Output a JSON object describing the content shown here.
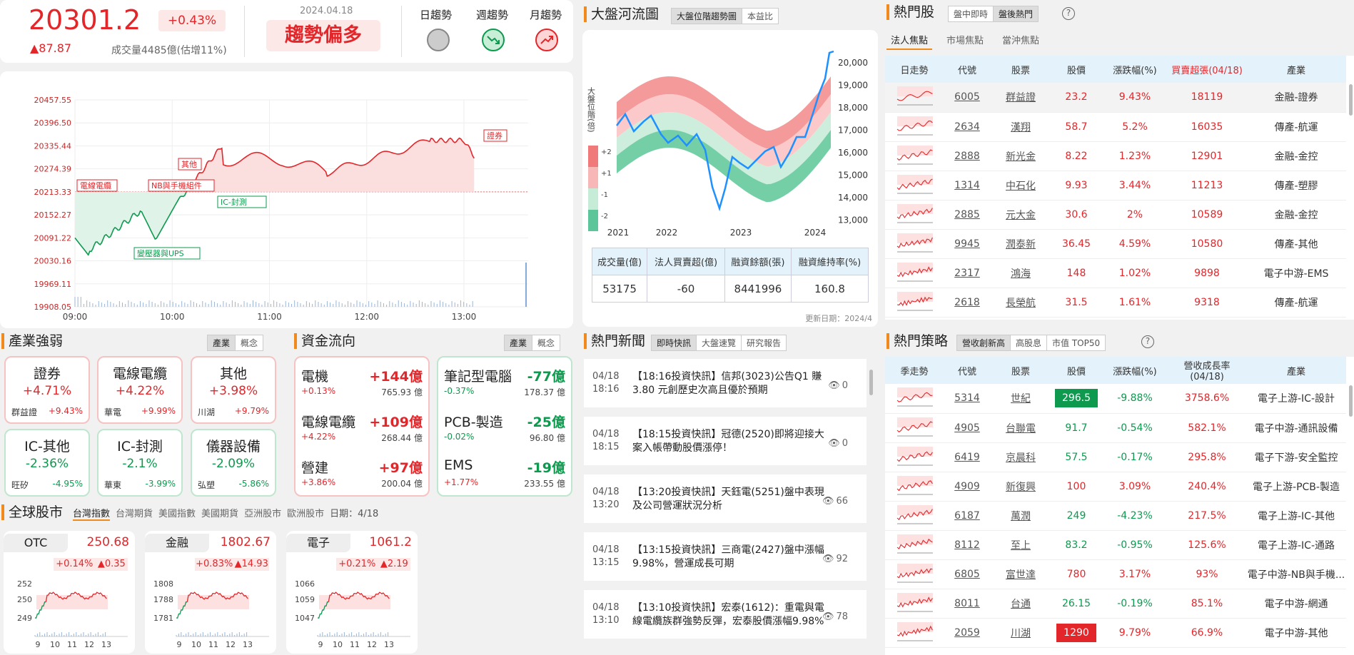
{
  "index": {
    "value": "20301.2",
    "change_pct": "+0.43%",
    "change_pts": "▲87.87",
    "volume": "成交量4485億(估增11%)",
    "date": "2024.04.18",
    "trend": "趨勢偏多",
    "trend_labels": [
      "日趨勢",
      "週趨勢",
      "月趨勢"
    ]
  },
  "main_chart": {
    "type": "line",
    "y_ticks": [
      "20457.55",
      "20396.50",
      "20335.44",
      "20274.39",
      "20213.33",
      "20152.27",
      "20091.22",
      "20030.16",
      "19969.11",
      "19908.05"
    ],
    "x_ticks": [
      "09:00",
      "10:00",
      "11:00",
      "12:00",
      "13:00"
    ],
    "reference": 20213.33,
    "ylim": [
      19908.05,
      20457.55
    ],
    "annotations": [
      "電線電纜",
      "NB與手機組件",
      "其他",
      "IC-封測",
      "變壓器與UPS",
      "證券"
    ]
  },
  "river": {
    "title": "大盤河流圖",
    "tabs": [
      "大盤位階趨勢圖",
      "本益比"
    ],
    "y_label": "大盤位階(倍)",
    "legend": [
      "+2",
      "+1",
      "-1",
      "-2"
    ],
    "y_ticks": [
      "20,000",
      "19,000",
      "18,000",
      "17,000",
      "16,000",
      "15,000",
      "14,000",
      "13,000"
    ],
    "x_ticks": [
      "2021",
      "2022",
      "2023",
      "2024"
    ],
    "table_headers": [
      "成交量(億)",
      "法人買賣超(億)",
      "融資餘額(張)",
      "融資維持率(%)"
    ],
    "table_values": [
      "53175",
      "-60",
      "8441996",
      "160.8"
    ],
    "updated": "更新日期：2024/4"
  },
  "hot_stocks": {
    "title": "熱門股",
    "tabs": [
      "盤中即時",
      "盤後熱門"
    ],
    "subtabs": [
      "法人焦點",
      "市場焦點",
      "當沖焦點"
    ],
    "headers": [
      "日走勢",
      "代號",
      "股票",
      "股價",
      "漲跌幅(%)",
      "買賣超張(04/18)",
      "產業"
    ],
    "rows": [
      {
        "code": "6005",
        "name": "群益證",
        "price": "23.2",
        "pct": "9.43%",
        "net": "18119",
        "ind": "金融-證券"
      },
      {
        "code": "2634",
        "name": "漢翔",
        "price": "58.7",
        "pct": "5.2%",
        "net": "16035",
        "ind": "傳產-航運"
      },
      {
        "code": "2888",
        "name": "新光金",
        "price": "8.22",
        "pct": "1.23%",
        "net": "12901",
        "ind": "金融-金控"
      },
      {
        "code": "1314",
        "name": "中石化",
        "price": "9.93",
        "pct": "3.44%",
        "net": "11213",
        "ind": "傳產-塑膠"
      },
      {
        "code": "2885",
        "name": "元大金",
        "price": "30.6",
        "pct": "2%",
        "net": "10589",
        "ind": "金融-金控"
      },
      {
        "code": "9945",
        "name": "潤泰新",
        "price": "36.45",
        "pct": "4.59%",
        "net": "10580",
        "ind": "傳產-其他"
      },
      {
        "code": "2317",
        "name": "鴻海",
        "price": "148",
        "pct": "1.02%",
        "net": "9898",
        "ind": "電子中游-EMS"
      },
      {
        "code": "2618",
        "name": "長榮航",
        "price": "31.5",
        "pct": "1.61%",
        "net": "9318",
        "ind": "傳產-航運"
      }
    ]
  },
  "industry": {
    "title": "產業強弱",
    "toggle": [
      "產業",
      "概念"
    ],
    "tiles": [
      {
        "name": "證券",
        "pct": "+4.71%",
        "stock": "群益證",
        "spct": "+9.43%",
        "up": true
      },
      {
        "name": "電線電纜",
        "pct": "+4.22%",
        "stock": "華電",
        "spct": "+9.99%",
        "up": true
      },
      {
        "name": "其他",
        "pct": "+3.98%",
        "stock": "川湖",
        "spct": "+9.79%",
        "up": true
      },
      {
        "name": "IC-其他",
        "pct": "-2.36%",
        "stock": "旺矽",
        "spct": "-4.95%",
        "up": false
      },
      {
        "name": "IC-封測",
        "pct": "-2.1%",
        "stock": "華東",
        "spct": "-3.99%",
        "up": false
      },
      {
        "name": "儀器設備",
        "pct": "-2.09%",
        "stock": "弘塑",
        "spct": "-5.86%",
        "up": false
      }
    ]
  },
  "capital": {
    "title": "資金流向",
    "toggle": [
      "產業",
      "概念"
    ],
    "left": [
      {
        "name": "電機",
        "amt": "+144億",
        "pct": "+0.13%",
        "total": "765.93 億"
      },
      {
        "name": "電線電纜",
        "amt": "+109億",
        "pct": "+4.22%",
        "total": "268.44 億"
      },
      {
        "name": "營建",
        "amt": "+97億",
        "pct": "+3.86%",
        "total": "200.04 億"
      }
    ],
    "right": [
      {
        "name": "筆記型電腦",
        "amt": "-77億",
        "pct": "-0.37%",
        "total": "178.37 億"
      },
      {
        "name": "PCB-製造",
        "amt": "-25億",
        "pct": "-0.02%",
        "total": "96.80 億"
      },
      {
        "name": "EMS",
        "amt": "-19億",
        "pct": "+1.77%",
        "total": "233.55 億"
      }
    ]
  },
  "global": {
    "title": "全球股市",
    "tabs": [
      "台灣指數",
      "台灣期貨",
      "美國指數",
      "美國期貨",
      "亞洲股市",
      "歐洲股市"
    ],
    "date": "日期：4/18",
    "cards": [
      {
        "name": "OTC",
        "price": "250.68",
        "pct": "+0.14%",
        "pts": "▲0.35",
        "y_ticks": [
          "252",
          "250",
          "249"
        ],
        "x_ticks": [
          "9",
          "10",
          "11",
          "12",
          "13"
        ]
      },
      {
        "name": "金融",
        "price": "1802.67",
        "pct": "+0.83%",
        "pts": "▲14.93",
        "y_ticks": [
          "1808",
          "1788",
          "1781"
        ],
        "x_ticks": [
          "9",
          "10",
          "11",
          "12",
          "13"
        ]
      },
      {
        "name": "電子",
        "price": "1061.2",
        "pct": "+0.21%",
        "pts": "▲2.19",
        "y_ticks": [
          "1066",
          "1059",
          "1047"
        ],
        "x_ticks": [
          "9",
          "10",
          "11",
          "12",
          "13"
        ]
      }
    ]
  },
  "news": {
    "title": "熱門新聞",
    "tabs": [
      "即時快訊",
      "大盤速覽",
      "研究報告"
    ],
    "items": [
      {
        "date": "04/18",
        "time": "18:16",
        "text": "【18:16投資快訊】信邦(3023)公告Q1 賺 3.80 元創歷史次高且優於預期",
        "views": "0"
      },
      {
        "date": "04/18",
        "time": "18:15",
        "text": "【18:15投資快訊】冠德(2520)即將迎接大案入帳帶動股價漲停！",
        "views": "0"
      },
      {
        "date": "04/18",
        "time": "13:20",
        "text": "【13:20投資快訊】天鈺電(5251)盤中表現及公司營運狀況分析",
        "views": "66"
      },
      {
        "date": "04/18",
        "time": "13:15",
        "text": "【13:15投資快訊】三商電(2427)盤中漲幅9.98%，營運成長可期",
        "views": "92"
      },
      {
        "date": "04/18",
        "time": "13:10",
        "text": "【13:10投資快訊】宏泰(1612)：重電與電線電纜族群強勢反彈，宏泰股價漲幅9.98%",
        "views": "78"
      }
    ]
  },
  "strategy": {
    "title": "熱門策略",
    "tabs": [
      "營收創新高",
      "高股息",
      "市值 TOP50"
    ],
    "headers": [
      "季走勢",
      "代號",
      "股票",
      "股價",
      "漲跌幅(%)",
      "營收成長率(04/18)",
      "產業"
    ],
    "rows": [
      {
        "code": "5314",
        "name": "世紀",
        "price": "296.5",
        "pct": "-9.88%",
        "growth": "3758.6%",
        "ind": "電子上游-IC-設計",
        "badge": "green"
      },
      {
        "code": "4905",
        "name": "台聯電",
        "price": "91.7",
        "pct": "-0.54%",
        "growth": "582.1%",
        "ind": "電子中游-通訊設備",
        "badge": ""
      },
      {
        "code": "6419",
        "name": "京晨科",
        "price": "57.5",
        "pct": "-0.17%",
        "growth": "295.8%",
        "ind": "電子下游-安全監控",
        "badge": ""
      },
      {
        "code": "4909",
        "name": "新復興",
        "price": "100",
        "pct": "3.09%",
        "growth": "240.4%",
        "ind": "電子上游-PCB-製造",
        "badge": ""
      },
      {
        "code": "6187",
        "name": "萬潤",
        "price": "249",
        "pct": "-4.23%",
        "growth": "217.5%",
        "ind": "電子上游-IC-其他",
        "badge": ""
      },
      {
        "code": "8112",
        "name": "至上",
        "price": "83.2",
        "pct": "-0.95%",
        "growth": "125.6%",
        "ind": "電子上游-IC-通路",
        "badge": ""
      },
      {
        "code": "6805",
        "name": "富世達",
        "price": "780",
        "pct": "3.17%",
        "growth": "93%",
        "ind": "電子中游-NB與手機...",
        "badge": ""
      },
      {
        "code": "8011",
        "name": "台通",
        "price": "26.15",
        "pct": "-0.19%",
        "growth": "85.1%",
        "ind": "電子中游-網通",
        "badge": ""
      },
      {
        "code": "2059",
        "name": "川湖",
        "price": "1290",
        "pct": "9.79%",
        "growth": "66.9%",
        "ind": "電子中游-其他",
        "badge": "red"
      }
    ]
  },
  "colors": {
    "up": "#e3262a",
    "down": "#0d9a4f",
    "accent": "#f08a1c",
    "header_bg": "#e4f3fb"
  }
}
